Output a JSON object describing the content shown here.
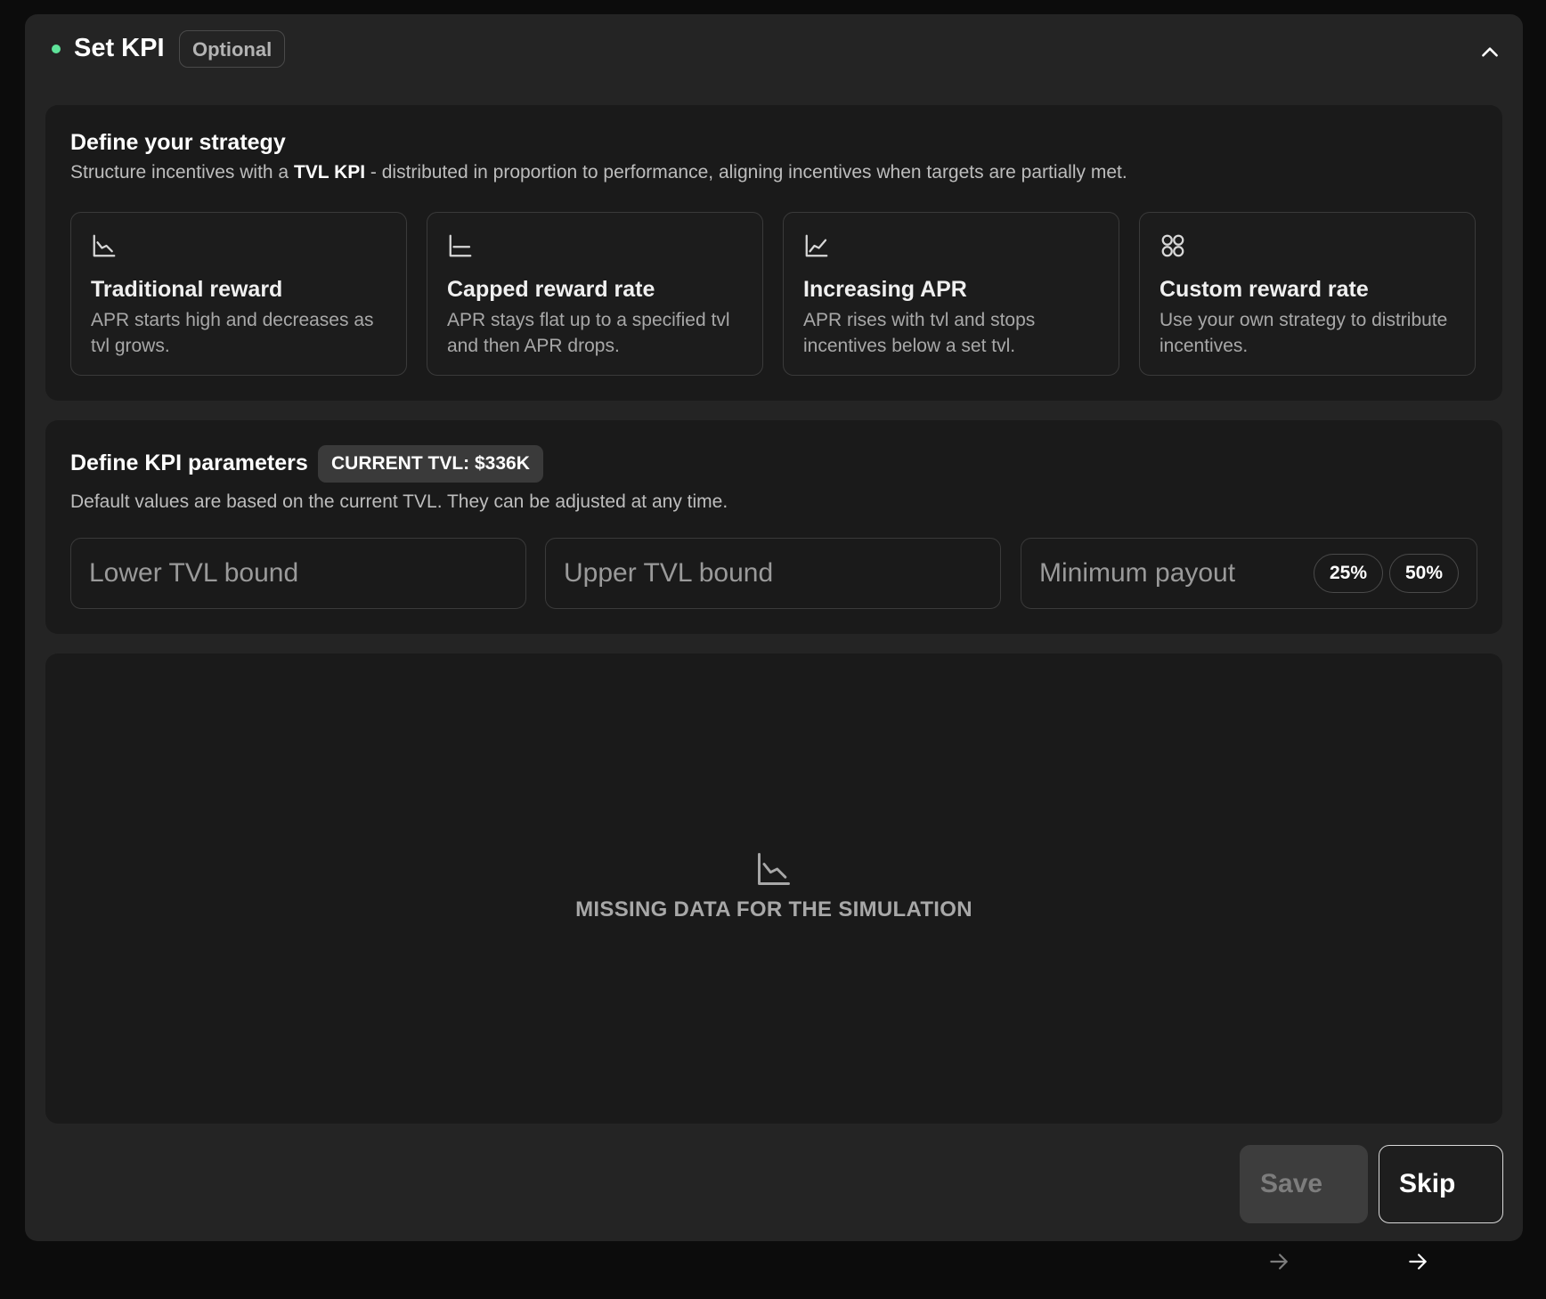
{
  "header": {
    "title": "Set KPI",
    "badge": "Optional",
    "dot_color": "#5fe39a"
  },
  "strategy": {
    "title": "Define your strategy",
    "desc_prefix": "Structure incentives with a ",
    "desc_bold": "TVL KPI",
    "desc_suffix": " - distributed in proportion to performance, aligning incentives when targets are partially met.",
    "options": [
      {
        "icon": "chart-decreasing-icon",
        "title": "Traditional reward",
        "desc": "APR starts high and decreases as tvl grows."
      },
      {
        "icon": "chart-flat-icon",
        "title": "Capped reward rate",
        "desc": "APR stays flat up to a specified tvl and then APR drops."
      },
      {
        "icon": "chart-increasing-icon",
        "title": "Increasing APR",
        "desc": "APR rises with tvl and stops incentives below a set tvl."
      },
      {
        "icon": "grid-circles-icon",
        "title": "Custom reward rate",
        "desc": "Use your own strategy to distribute incentives."
      }
    ]
  },
  "kpi": {
    "title": "Define KPI parameters",
    "tvl_badge": "CURRENT TVL: $336K",
    "desc": "Default values are based on the current TVL. They can be adjusted at any time.",
    "lower_placeholder": "Lower TVL bound",
    "upper_placeholder": "Upper TVL bound",
    "min_payout_placeholder": "Minimum payout",
    "chips": [
      "25%",
      "50%"
    ]
  },
  "simulation": {
    "icon": "chart-decreasing-icon",
    "message": "MISSING DATA FOR THE SIMULATION"
  },
  "actions": {
    "save_label": "Save",
    "skip_label": "Skip"
  }
}
